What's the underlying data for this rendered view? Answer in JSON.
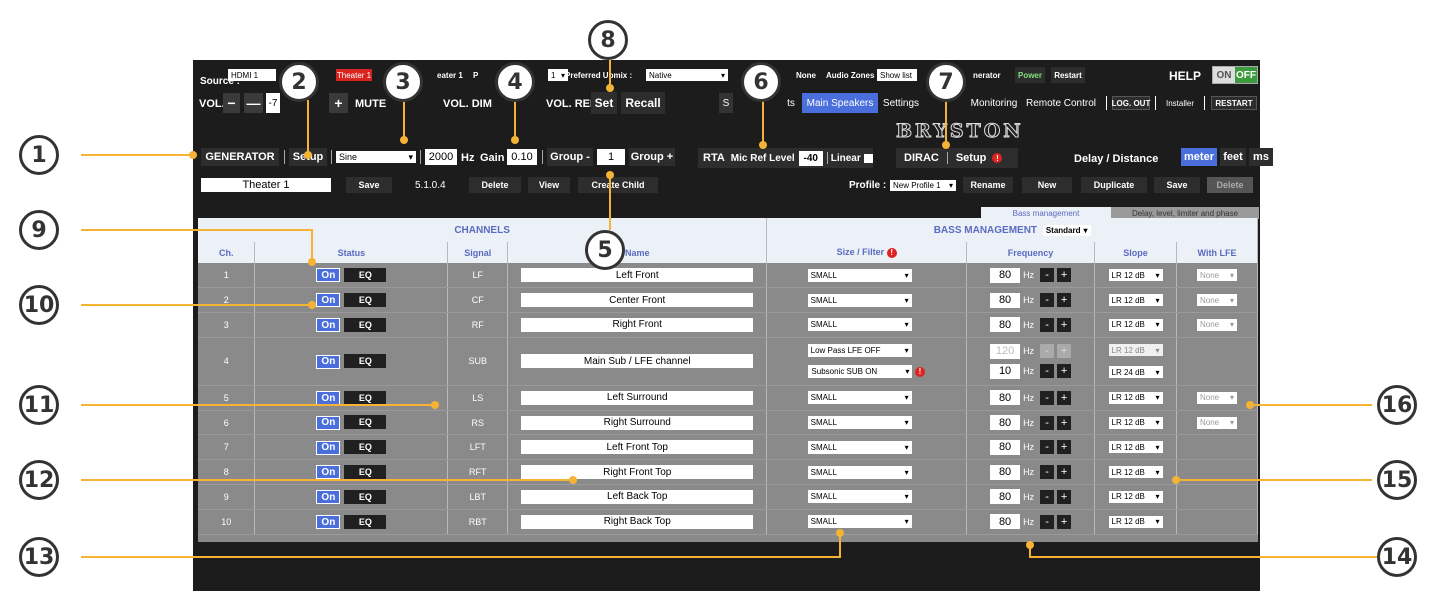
{
  "topbar": {
    "source_label": "Source :",
    "source_value": "HDMI 1",
    "theater_badge": "Theater 1",
    "theater_text": "eater 1",
    "p_label": "P",
    "p_select": "1",
    "upmix_label": "Preferred Upmix :",
    "upmix_value": "Native",
    "none_text": "None",
    "zones_label": "Audio Zones :",
    "zones_value": "Show list",
    "generator_text": "nerator",
    "power_label": "Power",
    "restart_label": "Restart",
    "help_label": "HELP",
    "on_label": "ON",
    "off_label": "OFF"
  },
  "volbar": {
    "vol_label": "VOL.",
    "minus": "−",
    "dash": "—",
    "vol_value": "-7",
    "plus": "+",
    "mute_label": "MUTE",
    "dim_label": "VOL. DIM",
    "ref_label": "VOL. REF",
    "set_label": "Set",
    "recall_label": "Recall"
  },
  "nav": {
    "tab_s": "S",
    "tab_ts": "ts",
    "main_speakers": "Main Speakers",
    "settings": "Settings",
    "monitoring": "Monitoring",
    "remote_control": "Remote Control",
    "logout": "LOG. OUT",
    "installer": "Installer",
    "restart": "RESTART",
    "logo": "BRYSTON"
  },
  "genbar": {
    "generator": "GENERATOR",
    "setup": "Setup",
    "waveform": "Sine",
    "freq_value": "2000",
    "hz": "Hz",
    "gain_label": "Gain",
    "gain_value": "0.10",
    "group_minus": "Group -",
    "group_value": "1",
    "group_plus": "Group +",
    "rta": "RTA",
    "mic_ref_label": "Mic Ref Level",
    "mic_ref_value": "-40",
    "linear_label": "Linear",
    "dirac": "DIRAC",
    "dirac_setup": "Setup",
    "delay_label": "Delay / Distance",
    "meter": "meter",
    "feet": "feet",
    "ms": "ms"
  },
  "profilebar": {
    "theater_name": "Theater 1",
    "save": "Save",
    "layout": "5.1.0.4",
    "delete": "Delete",
    "view": "View",
    "create_child": "Create Child",
    "profile_label": "Profile :",
    "profile_value": "New Profile 1",
    "rename": "Rename",
    "new": "New",
    "duplicate": "Duplicate",
    "save2": "Save",
    "delete2": "Delete"
  },
  "tabs": {
    "bass_management": "Bass management",
    "delay_level": "Delay, level, limiter and phase"
  },
  "table": {
    "channels_header": "CHANNELS",
    "bass_header": "BASS MANAGEMENT",
    "bass_mode": "Standard",
    "col_ch": "Ch.",
    "col_status": "Status",
    "col_signal": "Signal",
    "col_name": "Name",
    "col_size": "Size / Filter",
    "col_freq": "Frequency",
    "col_slope": "Slope",
    "col_lfe": "With LFE",
    "on_label": "On",
    "eq_label": "EQ",
    "hz_label": "Hz",
    "rows": [
      {
        "ch": "1",
        "signal": "LF",
        "name": "Left Front",
        "size": "SMALL",
        "freq": "80",
        "slope": "LR 12 dB",
        "lfe": "None"
      },
      {
        "ch": "2",
        "signal": "CF",
        "name": "Center Front",
        "size": "SMALL",
        "freq": "80",
        "slope": "LR 12 dB",
        "lfe": "None"
      },
      {
        "ch": "3",
        "signal": "RF",
        "name": "Right Front",
        "size": "SMALL",
        "freq": "80",
        "slope": "LR 12 dB",
        "lfe": "None"
      },
      {
        "ch": "5",
        "signal": "LS",
        "name": "Left Surround",
        "size": "SMALL",
        "freq": "80",
        "slope": "LR 12 dB",
        "lfe": "None"
      },
      {
        "ch": "6",
        "signal": "RS",
        "name": "Right Surround",
        "size": "SMALL",
        "freq": "80",
        "slope": "LR 12 dB",
        "lfe": "None"
      },
      {
        "ch": "7",
        "signal": "LFT",
        "name": "Left Front Top",
        "size": "SMALL",
        "freq": "80",
        "slope": "LR 12 dB",
        "lfe": ""
      },
      {
        "ch": "8",
        "signal": "RFT",
        "name": "Right Front Top",
        "size": "SMALL",
        "freq": "80",
        "slope": "LR 12 dB",
        "lfe": ""
      },
      {
        "ch": "9",
        "signal": "LBT",
        "name": "Left Back Top",
        "size": "SMALL",
        "freq": "80",
        "slope": "LR 12 dB",
        "lfe": ""
      },
      {
        "ch": "10",
        "signal": "RBT",
        "name": "Right Back Top",
        "size": "SMALL",
        "freq": "80",
        "slope": "LR 12 dB",
        "lfe": ""
      }
    ],
    "sub": {
      "ch": "4",
      "signal": "SUB",
      "name": "Main Sub / LFE channel",
      "filter1": "Low Pass LFE OFF",
      "filter2": "Subsonic SUB ON",
      "freq1": "120",
      "freq2": "10",
      "slope1": "LR 12 dB",
      "slope2": "LR 24 dB"
    }
  },
  "callouts": [
    "1",
    "2",
    "3",
    "4",
    "5",
    "6",
    "7",
    "8",
    "9",
    "10",
    "11",
    "12",
    "13",
    "14",
    "15",
    "16"
  ],
  "colors": {
    "accent": "#4a6fdc",
    "callout_line": "#f5b335",
    "warning": "#dd2222",
    "power": "#2a7a2a"
  }
}
